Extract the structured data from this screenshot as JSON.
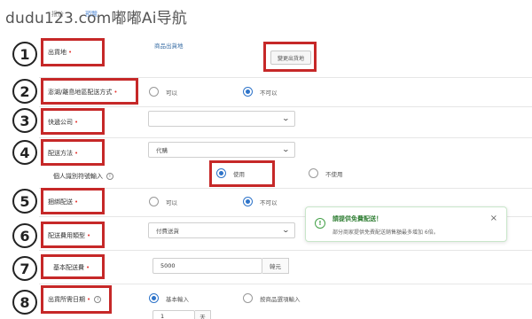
{
  "watermark": "dudu123.com嘟嘟Ai导航",
  "topnav": {
    "item1": "报价",
    "item2": "預覽"
  },
  "rows": {
    "r1": {
      "num": "1",
      "label": "出貨地",
      "sublabel": "商品出貨地",
      "button": "變更出貨地"
    },
    "r2": {
      "num": "2",
      "label": "澎湖/離島地區配送方式",
      "opt1": "可以",
      "opt2": "不可以",
      "selected": "opt2"
    },
    "r3": {
      "num": "3",
      "label": "快遞公司",
      "value": ""
    },
    "r4": {
      "num": "4",
      "label": "配送方法",
      "value": "代購",
      "sub_label": "個人識別符號輸入",
      "opt1": "使用",
      "opt2": "不使用",
      "selected": "opt1"
    },
    "r5": {
      "num": "5",
      "label": "捆綁配送",
      "opt1": "可以",
      "opt2": "不可以",
      "selected": "opt2"
    },
    "r6": {
      "num": "6",
      "label": "配送費用類型",
      "value": "付費送貨"
    },
    "r7": {
      "num": "7",
      "label": "基本配送費",
      "value": "5000",
      "unit": "韓元"
    },
    "r8": {
      "num": "8",
      "label": "出貨所需日期",
      "opt1": "基本輸入",
      "opt2": "按商品選項輸入",
      "selected": "opt1",
      "days_value": "1",
      "days_unit": "天"
    }
  },
  "toast": {
    "title": "請提供免費配送！",
    "body": "部分商家提供免費配送銷售額最多增加 6倍。",
    "close": "×"
  },
  "colors": {
    "accent": "#2e74c9",
    "highlight_box": "#c62828",
    "success": "#43a047"
  },
  "icons": {
    "chevron": "chevron-down-icon",
    "info": "info-icon",
    "check": "check-circle-icon",
    "close": "close-icon"
  }
}
